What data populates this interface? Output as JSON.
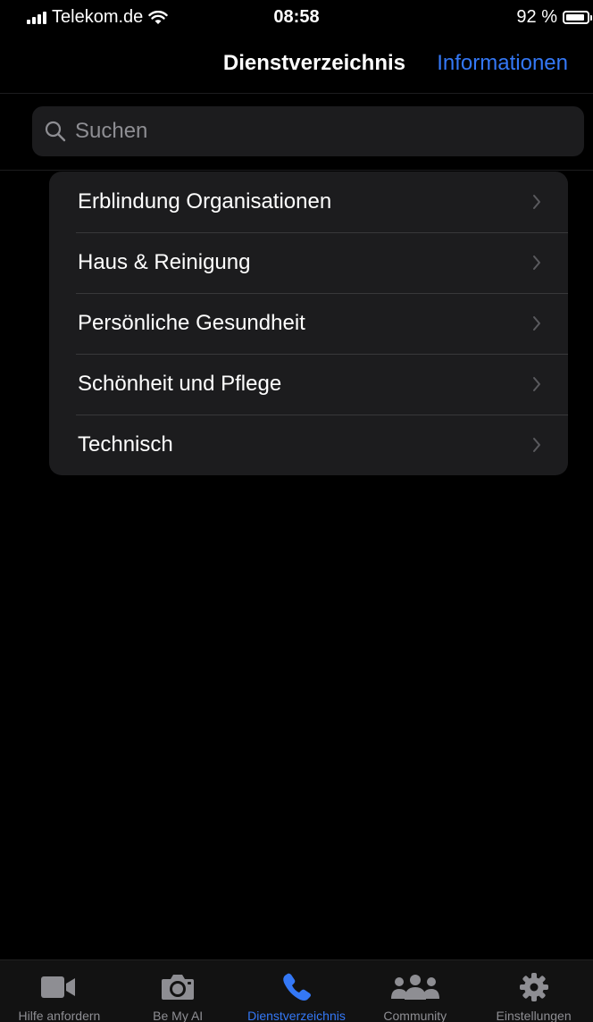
{
  "status_bar": {
    "carrier": "Telekom.de",
    "time": "08:58",
    "battery_text": "92 %",
    "battery_level": 0.92
  },
  "nav": {
    "title": "Dienstverzeichnis",
    "action_label": "Informationen",
    "accent_color": "#3478f6"
  },
  "search": {
    "placeholder": "Suchen",
    "value": ""
  },
  "categories": [
    {
      "label": "Erblindung Organisationen",
      "icon": "chevron-right-icon"
    },
    {
      "label": "Haus & Reinigung",
      "icon": "chevron-right-icon"
    },
    {
      "label": "Persönliche Gesundheit",
      "icon": "chevron-right-icon"
    },
    {
      "label": "Schönheit und Pflege",
      "icon": "chevron-right-icon"
    },
    {
      "label": "Technisch",
      "icon": "chevron-right-icon"
    }
  ],
  "tabs": [
    {
      "label": "Hilfe anfordern",
      "icon": "video-camera-icon",
      "active": false
    },
    {
      "label": "Be My AI",
      "icon": "camera-icon",
      "active": false
    },
    {
      "label": "Dienstverzeichnis",
      "icon": "phone-icon",
      "active": true
    },
    {
      "label": "Community",
      "icon": "people-icon",
      "active": false
    },
    {
      "label": "Einstellungen",
      "icon": "gear-icon",
      "active": false
    }
  ]
}
